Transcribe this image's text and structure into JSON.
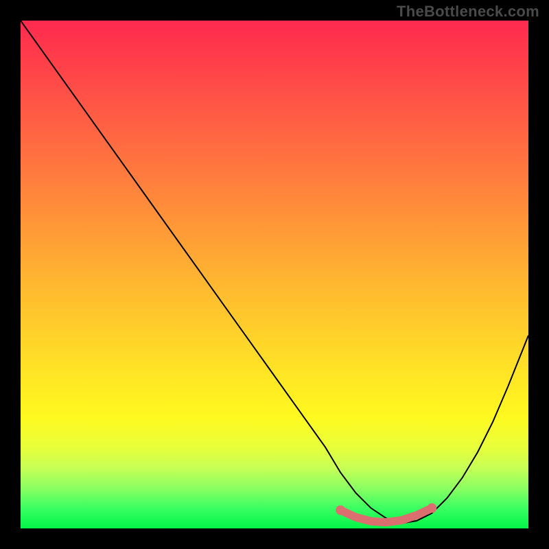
{
  "watermark": "TheBottleneck.com",
  "colors": {
    "background": "#000000",
    "gradient_top": "#ff2a4f",
    "gradient_bottom": "#03f548",
    "curve": "#000000",
    "highlight": "#db6f6f"
  },
  "chart_data": {
    "type": "line",
    "title": "",
    "xlabel": "",
    "ylabel": "",
    "xlim": [
      0,
      100
    ],
    "ylim": [
      0,
      100
    ],
    "grid": false,
    "annotations": [],
    "series": [
      {
        "name": "bottleneck-curve",
        "x": [
          0,
          5,
          10,
          15,
          20,
          25,
          30,
          35,
          40,
          45,
          50,
          55,
          60,
          63,
          66,
          69,
          72,
          75,
          78,
          81,
          84,
          87,
          90,
          93,
          96,
          100
        ],
        "y": [
          100,
          93,
          86,
          79,
          72,
          65,
          58,
          51,
          44,
          37,
          30,
          23,
          16,
          11,
          7,
          4,
          2,
          1,
          1.5,
          3,
          6,
          10,
          15,
          21,
          28,
          38
        ]
      }
    ],
    "highlight": {
      "name": "optimal-range",
      "x_range": [
        63,
        81
      ],
      "path_y": [
        3.6,
        2.2,
        1.4,
        1.2,
        1.6,
        2.6,
        4.0
      ],
      "endpoints": [
        {
          "x": 63,
          "y": 3.6
        },
        {
          "x": 81,
          "y": 4.0
        }
      ]
    }
  }
}
